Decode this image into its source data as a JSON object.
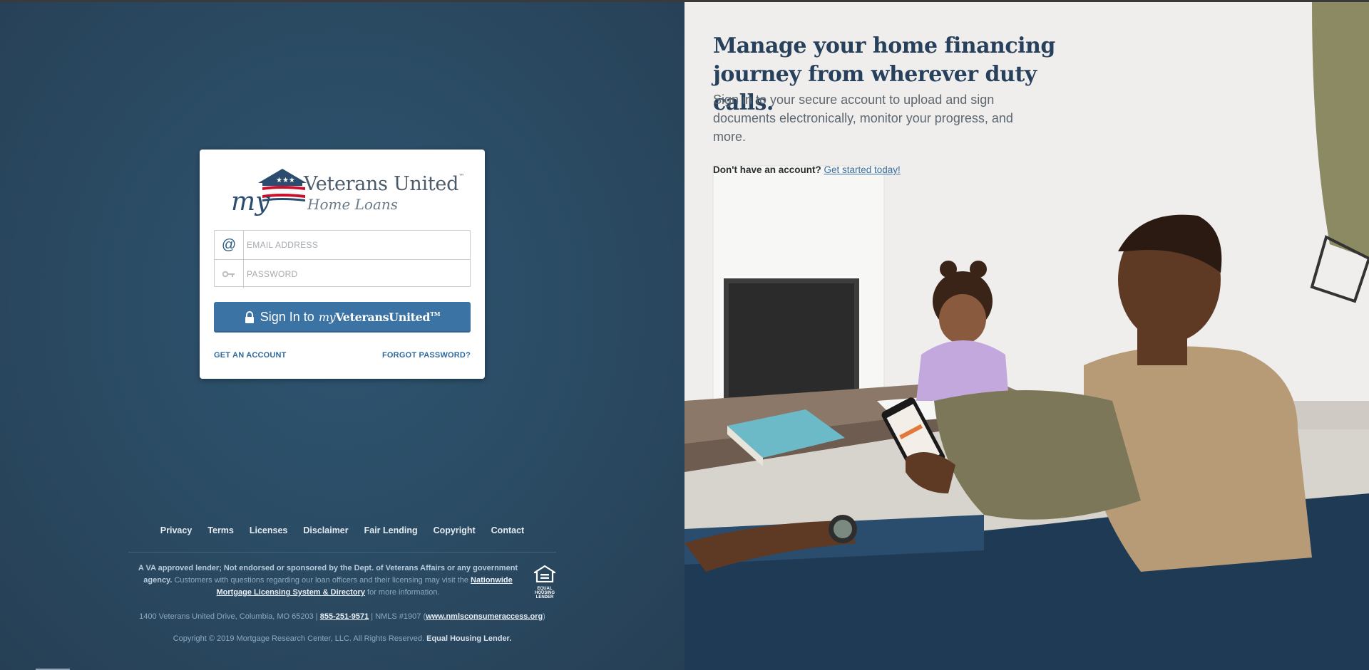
{
  "login": {
    "logo": {
      "my": "my",
      "brand": "Veterans United",
      "sub": "Home Loans"
    },
    "email_placeholder": "EMAIL ADDRESS",
    "password_placeholder": "PASSWORD",
    "signin_prefix": "Sign In to",
    "signin_brand_my": "my",
    "signin_brand_name": "VeteransUnited",
    "signin_brand_tm": "TM",
    "get_account": "GET AN ACCOUNT",
    "forgot_password": "FORGOT PASSWORD?"
  },
  "footer": {
    "nav": [
      "Privacy",
      "Terms",
      "Licenses",
      "Disclaimer",
      "Fair Lending",
      "Copyright",
      "Contact"
    ],
    "disclaimer_bold": "A VA approved lender; Not endorsed or sponsored by the Dept. of Veterans Affairs or any government agency.",
    "disclaimer_text": "Customers with questions regarding our loan officers and their licensing may visit the",
    "disclaimer_link": "Nationwide Mortgage Licensing System & Directory",
    "disclaimer_tail": "for more information.",
    "ehl_label": "EQUAL HOUSING LENDER",
    "address": "1400 Veterans United Drive, Columbia, MO 65203 |",
    "phone": "855-251-9571",
    "nmls": "| NMLS #1907 (",
    "nmls_link": "www.nmlsconsumeraccess.org",
    "nmls_close": ")",
    "copyright": "Copyright © 2019 Mortgage Research Center, LLC. All Rights Reserved.",
    "copyright_bold": "Equal Housing Lender."
  },
  "hero": {
    "headline": "Manage your home financing journey from wherever duty calls.",
    "subtext": "Sign in to your secure account to upload and sign documents electronically, monitor your progress, and more.",
    "cta_text": "Don't have an account?",
    "cta_link": "Get started today!"
  },
  "colors": {
    "panel": "#2b4a63",
    "button": "#3a73a4",
    "link": "#2f6a9d",
    "headline": "#27415c"
  }
}
